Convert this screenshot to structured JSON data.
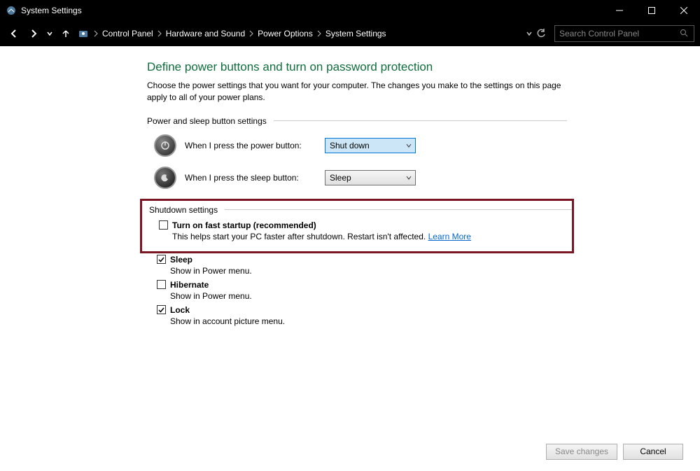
{
  "titlebar": {
    "title": "System Settings"
  },
  "breadcrumb": {
    "items": [
      "Control Panel",
      "Hardware and Sound",
      "Power Options",
      "System Settings"
    ]
  },
  "search": {
    "placeholder": "Search Control Panel"
  },
  "heading": "Define power buttons and turn on password protection",
  "description": "Choose the power settings that you want for your computer. The changes you make to the settings on this page apply to all of your power plans.",
  "section_power_sleep": "Power and sleep button settings",
  "power_button": {
    "label": "When I press the power button:",
    "value": "Shut down"
  },
  "sleep_button": {
    "label": "When I press the sleep button:",
    "value": "Sleep"
  },
  "section_shutdown": "Shutdown settings",
  "shutdown_items": {
    "fast_startup": {
      "label": "Turn on fast startup (recommended)",
      "desc": "This helps start your PC faster after shutdown. Restart isn't affected. ",
      "link": "Learn More",
      "checked": false
    },
    "sleep": {
      "label": "Sleep",
      "desc": "Show in Power menu.",
      "checked": true
    },
    "hibernate": {
      "label": "Hibernate",
      "desc": "Show in Power menu.",
      "checked": false
    },
    "lock": {
      "label": "Lock",
      "desc": "Show in account picture menu.",
      "checked": true
    }
  },
  "buttons": {
    "save": "Save changes",
    "cancel": "Cancel"
  }
}
